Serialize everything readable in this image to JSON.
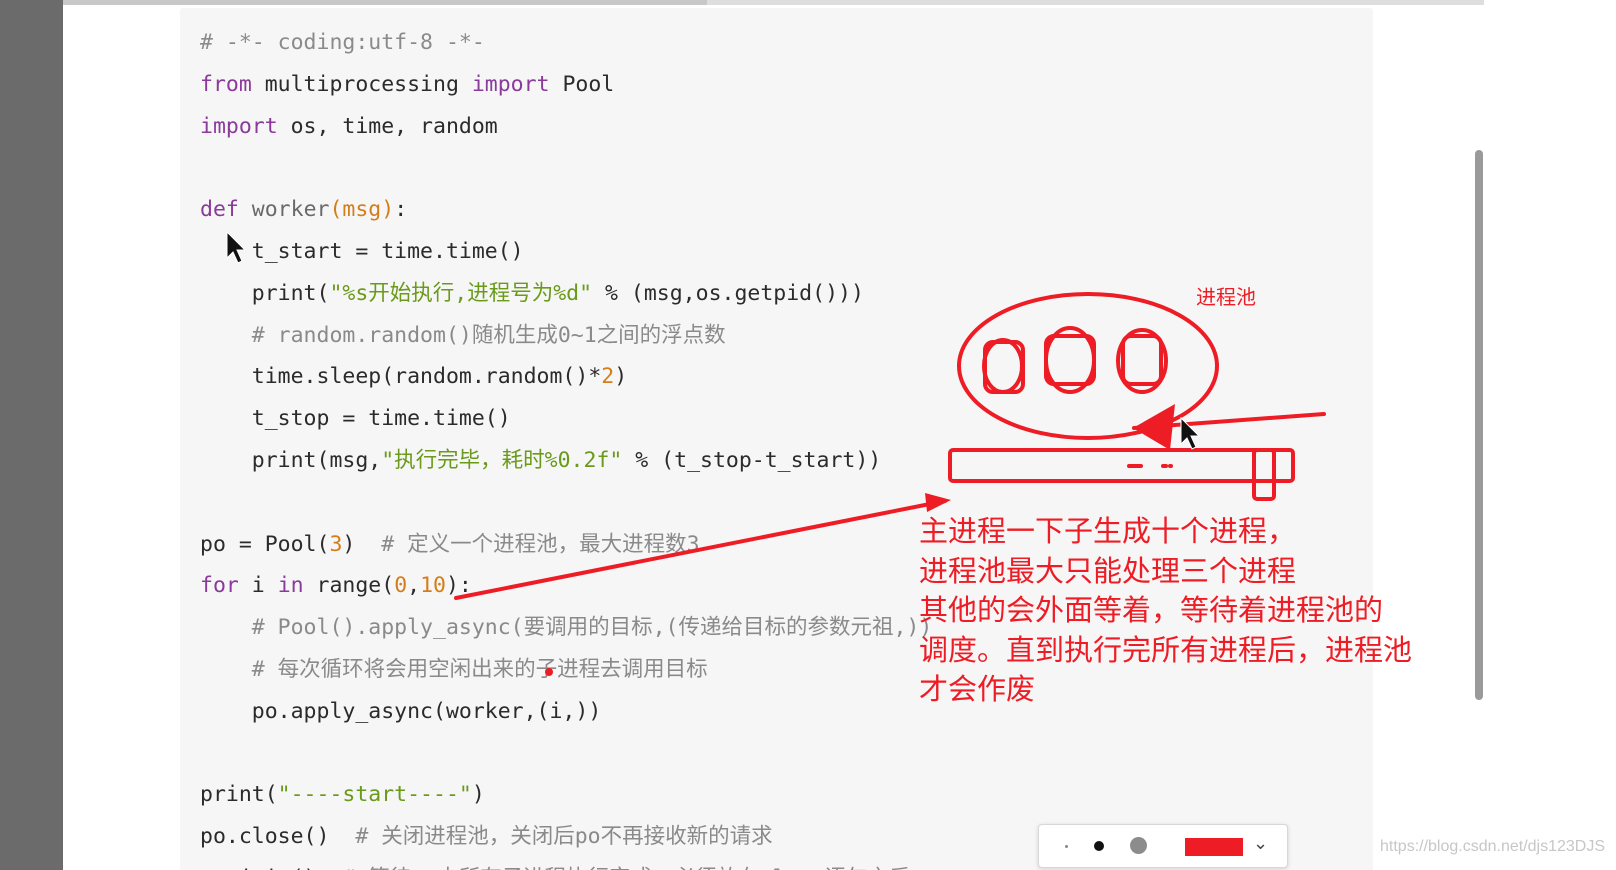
{
  "code": {
    "lines": [
      [
        {
          "t": "# -*- coding:utf-8 -*-",
          "c": "cm"
        }
      ],
      [
        {
          "t": "from",
          "c": "kw"
        },
        {
          "t": " multiprocessing ",
          "c": ""
        },
        {
          "t": "import",
          "c": "kw"
        },
        {
          "t": " Pool",
          "c": ""
        }
      ],
      [
        {
          "t": "import",
          "c": "kw"
        },
        {
          "t": " os, time, random",
          "c": ""
        }
      ],
      [],
      [
        {
          "t": "def",
          "c": "kw"
        },
        {
          "t": " worker",
          "c": "fn"
        },
        {
          "t": "(msg)",
          "c": "param"
        },
        {
          "t": ":",
          "c": ""
        }
      ],
      [
        {
          "t": "    t_start = time.time()",
          "c": ""
        }
      ],
      [
        {
          "t": "    print(",
          "c": ""
        },
        {
          "t": "\"%s开始执行,进程号为%d\"",
          "c": "str"
        },
        {
          "t": " % (msg,os.getpid()))",
          "c": ""
        }
      ],
      [
        {
          "t": "    # random.random()随机生成0~1之间的浮点数",
          "c": "cm"
        }
      ],
      [
        {
          "t": "    time.sleep(random.random()*",
          "c": ""
        },
        {
          "t": "2",
          "c": "num"
        },
        {
          "t": ")",
          "c": ""
        }
      ],
      [
        {
          "t": "    t_stop = time.time()",
          "c": ""
        }
      ],
      [
        {
          "t": "    print(msg,",
          "c": ""
        },
        {
          "t": "\"执行完毕，耗时%0.2f\"",
          "c": "str"
        },
        {
          "t": " % (t_stop-t_start))",
          "c": ""
        }
      ],
      [],
      [
        {
          "t": "po = Pool(",
          "c": ""
        },
        {
          "t": "3",
          "c": "num"
        },
        {
          "t": ")  ",
          "c": ""
        },
        {
          "t": "# 定义一个进程池，最大进程数3",
          "c": "cm"
        }
      ],
      [
        {
          "t": "for",
          "c": "kw"
        },
        {
          "t": " i ",
          "c": ""
        },
        {
          "t": "in",
          "c": "kw"
        },
        {
          "t": " range(",
          "c": ""
        },
        {
          "t": "0",
          "c": "num"
        },
        {
          "t": ",",
          "c": ""
        },
        {
          "t": "10",
          "c": "num"
        },
        {
          "t": "):",
          "c": ""
        }
      ],
      [
        {
          "t": "    # Pool().apply_async(要调用的目标,(传递给目标的参数元祖,))",
          "c": "cm"
        }
      ],
      [
        {
          "t": "    # 每次循环将会用空闲出来的子进程去调用目标",
          "c": "cm"
        }
      ],
      [
        {
          "t": "    po.apply_async(worker,(i,))",
          "c": ""
        }
      ],
      [],
      [
        {
          "t": "print(",
          "c": ""
        },
        {
          "t": "\"----start----\"",
          "c": "str"
        },
        {
          "t": ")",
          "c": ""
        }
      ],
      [
        {
          "t": "po.close()  ",
          "c": ""
        },
        {
          "t": "# 关闭进程池，关闭后po不再接收新的请求",
          "c": "cm"
        }
      ],
      [
        {
          "t": "po.join()  ",
          "c": ""
        },
        {
          "t": "# 等待po中所有子进程执行完成，必须放在close语句之后",
          "c": "cm"
        }
      ]
    ]
  },
  "annotation": {
    "pool_label": "进程池",
    "note_lines": [
      "主进程一下子生成十个进程，",
      "进程池最大只能处理三个进程",
      "其他的会外面等着，等待着进程池的",
      "调度。直到执行完所有进程后，进程池",
      "才会作废"
    ],
    "ink_color": "#ee1c24"
  },
  "pen_toolbar": {
    "selected_color": "#ee1c24",
    "chevron_icon": "chevron-down-icon"
  },
  "watermark": "https://blog.csdn.net/djs123DJS"
}
